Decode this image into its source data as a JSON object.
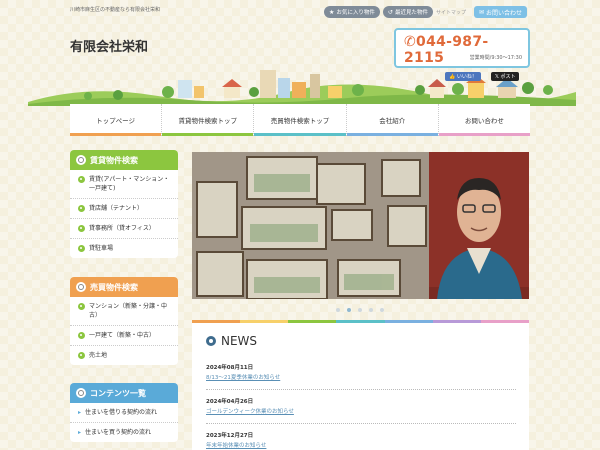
{
  "header": {
    "tagline": "川崎市麻生区の不動産なら有限会社栄和",
    "favorites_label": "お気に入り物件",
    "recent_label": "最近見た物件",
    "sitemap_label": "サイトマップ",
    "contact_label": "お問い合わせ",
    "company_name": "有限会社栄和",
    "phone": "044-987-2115",
    "hours": "営業時間/9:30～17:30",
    "like_label": "いいね！",
    "post_label": "ポスト"
  },
  "nav": {
    "items": [
      {
        "label": "トップページ",
        "color": "#f0a050"
      },
      {
        "label": "賃貸物件検索トップ",
        "color": "#8cc63f"
      },
      {
        "label": "売買物件検索トップ",
        "color": "#5bc0c8"
      },
      {
        "label": "会社紹介",
        "color": "#7ab0e0"
      },
      {
        "label": "お問い合わせ",
        "color": "#e8a0c8"
      }
    ]
  },
  "sidebar": {
    "rent": {
      "title": "賃貸物件検索",
      "color": "#8cc63f",
      "items": [
        "賃貸(アパート・マンション・一戸建て)",
        "貸店舗（テナント）",
        "貸事務所（貸オフィス）",
        "貸駐車場"
      ]
    },
    "sale": {
      "title": "売買物件検索",
      "color": "#f0a050",
      "items": [
        "マンション（新築・分譲・中古）",
        "一戸建て（新築・中古）",
        "売土地"
      ]
    },
    "contents": {
      "title": "コンテンツ一覧",
      "color": "#5aaad8",
      "items": [
        "住まいを借りる契約の流れ",
        "住まいを買う契約の流れ"
      ]
    }
  },
  "news": {
    "title": "NEWS",
    "items": [
      {
        "date": "2024年08月11日",
        "text": "8/13～21夏季休業のお知らせ"
      },
      {
        "date": "2024年04月26日",
        "text": "ゴールデンウィーク休業のお知らせ"
      },
      {
        "date": "2023年12月27日",
        "text": "年末年始休業のお知らせ"
      }
    ]
  },
  "colors": {
    "accent_blue": "#7ec6e0",
    "phone_orange": "#e06a3a",
    "link_blue": "#5a8fb5"
  }
}
